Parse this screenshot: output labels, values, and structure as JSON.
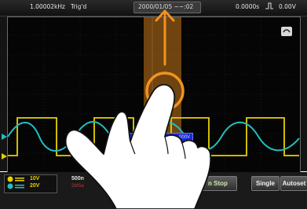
{
  "status_bar": {
    "frequency": "1.00002kHz",
    "trigger_status": "Trig'd",
    "datetime": "2000/01/05 ~~:02",
    "horizontal_position": "0.0000s",
    "trigger_level": "0.00V"
  },
  "bottom_bar": {
    "ch1_scale": "10V",
    "ch2_scale": "20V",
    "timebase": "500n",
    "timebase_sub": "2MSa",
    "run_stop": "n Stop",
    "single": "Single",
    "autoset": "Autoset"
  },
  "overlay": {
    "measure_label": "000V",
    "gesture": "vertical drag (scroll up/down)"
  },
  "colors": {
    "ch1": "#e8d000",
    "ch2": "#20c0c0",
    "accent": "#f29220"
  }
}
